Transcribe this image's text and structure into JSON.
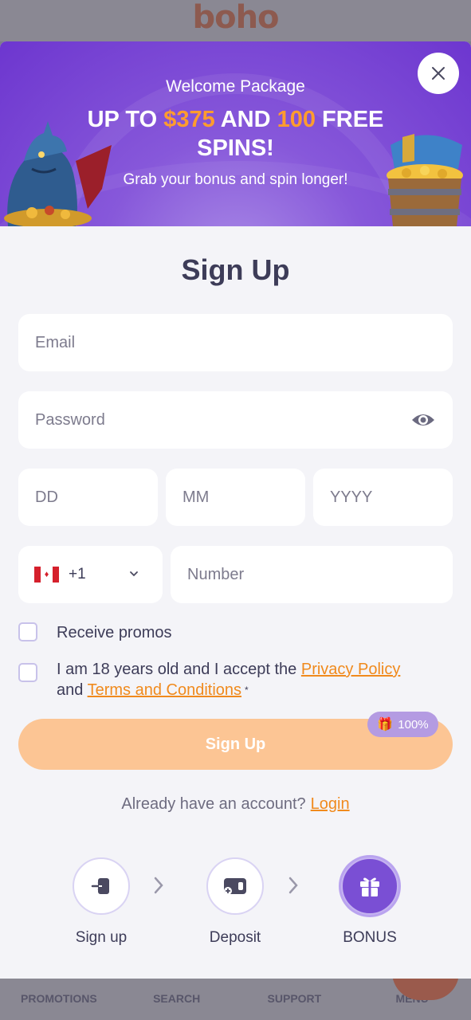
{
  "app": {
    "logo": "boho"
  },
  "bottom_nav": {
    "items": [
      "PROMOTIONS",
      "SEARCH",
      "SUPPORT",
      "MENU"
    ]
  },
  "banner": {
    "welcome": "Welcome Package",
    "headline": {
      "part1": "UP TO ",
      "amount": "$375",
      "part2": " AND ",
      "spins": "100",
      "part3": " FREE SPINS!"
    },
    "subtitle": "Grab your bonus and spin longer!"
  },
  "form": {
    "title": "Sign Up",
    "email_placeholder": "Email",
    "password_placeholder": "Password",
    "day_placeholder": "DD",
    "month_placeholder": "MM",
    "year_placeholder": "YYYY",
    "country_code": "+1",
    "number_placeholder": "Number",
    "promos_label": "Receive promos",
    "terms": {
      "prefix": "I am 18 years old and I accept the ",
      "privacy": "Privacy Policy",
      "and": " and ",
      "terms": "Terms and Conditions",
      "req": "*"
    },
    "submit_label": "Sign Up",
    "badge": "100%"
  },
  "login": {
    "prompt": "Already have an account?",
    "link": "Login"
  },
  "steps": [
    {
      "label": "Sign up",
      "icon": "sign-in-icon"
    },
    {
      "label": "Deposit",
      "icon": "wallet-icon"
    },
    {
      "label": "BONUS",
      "icon": "gift-icon"
    }
  ],
  "colors": {
    "accent": "#f08a1d",
    "primary": "#7a4fd4",
    "button": "#fcc594",
    "banner": "#6d36cf"
  }
}
